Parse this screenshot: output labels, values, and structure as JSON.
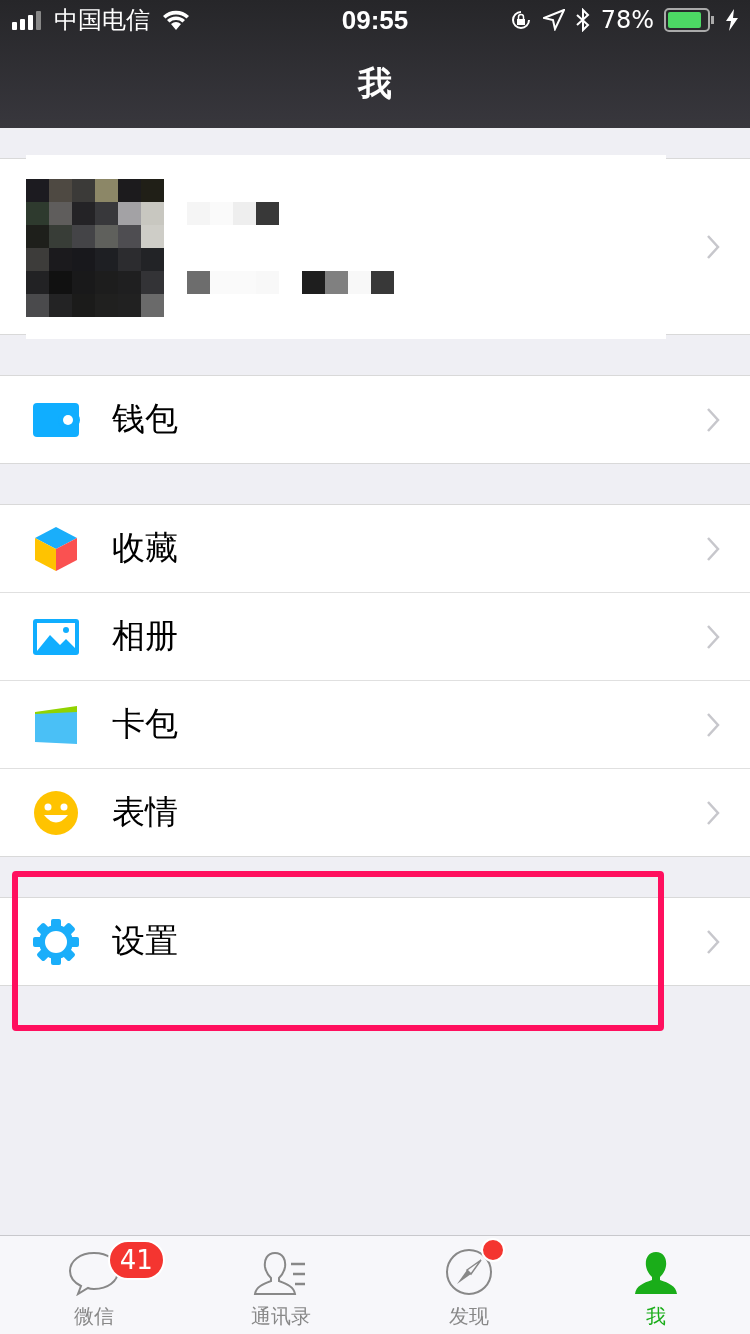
{
  "status_bar": {
    "carrier": "中国电信",
    "time": "09:55",
    "battery": "78%"
  },
  "nav": {
    "title": "我"
  },
  "sections": [
    [
      {
        "label": "钱包",
        "kind": "wallet",
        "highlighted": false
      }
    ],
    [
      {
        "label": "收藏",
        "kind": "cube",
        "highlighted": false
      },
      {
        "label": "相册",
        "highlighted": false
      },
      {
        "label": "卡包",
        "kind": "card",
        "highlighted": false
      },
      {
        "label": "表情",
        "kind": "smile",
        "highlighted": false
      }
    ],
    [
      {
        "label": "设置",
        "kind": "gear",
        "highlighted": true
      }
    ]
  ],
  "tabs": [
    {
      "label": "微信",
      "kind": "chat",
      "selected": false,
      "badge": "41",
      "dot": false
    },
    {
      "label": "通讯录",
      "kind": "contacts",
      "selected": false,
      "dot": false
    },
    {
      "label": "发现",
      "kind": "compass",
      "selected": false,
      "dot": true
    },
    {
      "label": "我",
      "kind": "me",
      "selected": true,
      "dot": false
    }
  ]
}
